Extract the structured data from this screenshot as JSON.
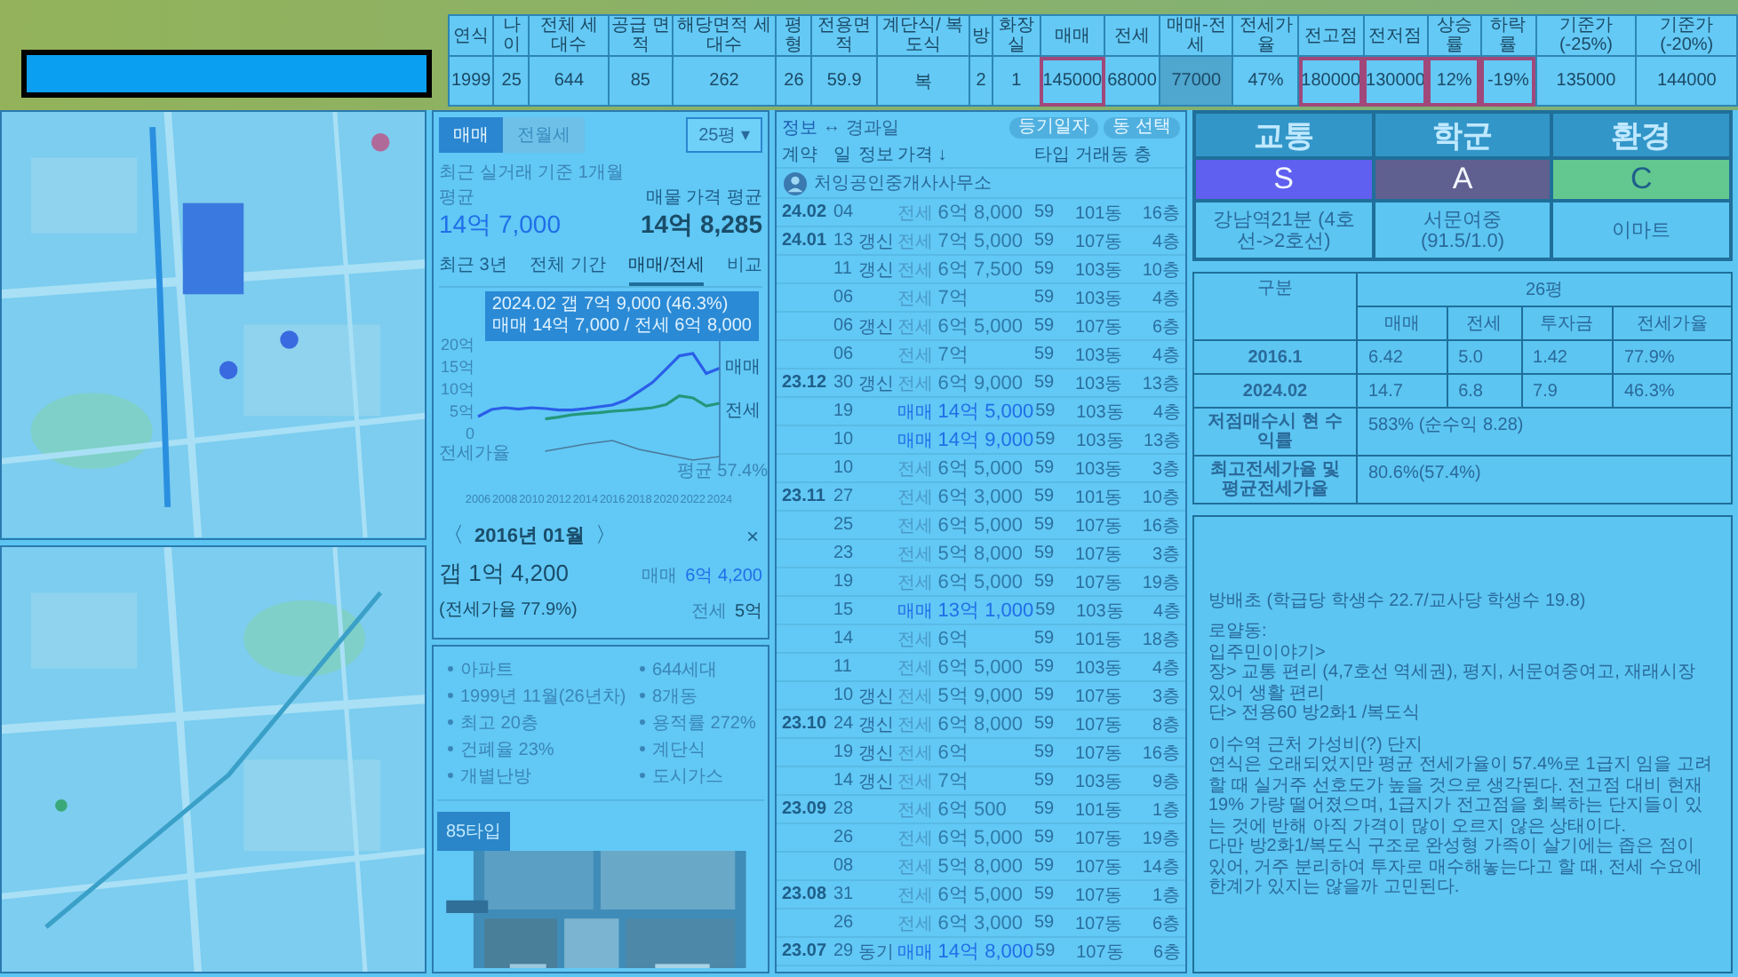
{
  "summary_table": {
    "columns": [
      "연식",
      "나이",
      "전체 세대수",
      "공급 면적",
      "해당면적 세대수",
      "평형",
      "전용면적",
      "계단식/ 복도식",
      "방",
      "화장실",
      "매매",
      "전세",
      "매매-전세",
      "전세가율",
      "전고점",
      "전저점",
      "상승률",
      "하락률",
      "기준가 (-25%)",
      "기준가 (-20%)"
    ],
    "cells": [
      {
        "text": "1999",
        "outlined": false,
        "shaded": false
      },
      {
        "text": "25",
        "outlined": false,
        "shaded": false
      },
      {
        "text": "644",
        "outlined": false,
        "shaded": false
      },
      {
        "text": "85",
        "outlined": false,
        "shaded": false
      },
      {
        "text": "262",
        "outlined": false,
        "shaded": false
      },
      {
        "text": "26",
        "outlined": false,
        "shaded": false
      },
      {
        "text": "59.9",
        "outlined": false,
        "shaded": false
      },
      {
        "text": "복",
        "outlined": false,
        "shaded": false
      },
      {
        "text": "2",
        "outlined": false,
        "shaded": false
      },
      {
        "text": "1",
        "outlined": false,
        "shaded": false
      },
      {
        "text": "145000",
        "outlined": true,
        "shaded": false
      },
      {
        "text": "68000",
        "outlined": false,
        "shaded": false
      },
      {
        "text": "77000",
        "outlined": false,
        "shaded": true
      },
      {
        "text": "47%",
        "outlined": false,
        "shaded": false
      },
      {
        "text": "180000",
        "outlined": true,
        "shaded": false
      },
      {
        "text": "130000",
        "outlined": true,
        "shaded": false
      },
      {
        "text": "12%",
        "outlined": true,
        "shaded": false
      },
      {
        "text": "-19%",
        "outlined": true,
        "shaded": false
      },
      {
        "text": "135000",
        "outlined": false,
        "shaded": false
      },
      {
        "text": "144000",
        "outlined": false,
        "shaded": false
      }
    ]
  },
  "price_panel": {
    "tabs": [
      {
        "label": "매매",
        "selected": true
      },
      {
        "label": "전월세",
        "selected": false
      }
    ],
    "size_select": {
      "value": "25평",
      "caret": "▾"
    },
    "recent_label": "최근 실거래 기준 1개월 평균",
    "recent_value": "14억 7,000",
    "listing_label": "매물 가격 평균",
    "listing_value": "14억 8,285",
    "views": [
      {
        "label": "최근 3년",
        "selected": false
      },
      {
        "label": "전체 기간",
        "selected": false
      },
      {
        "label": "매매/전세",
        "selected": true
      },
      {
        "label": "비교",
        "selected": false
      }
    ],
    "tooltip": {
      "title": "2024.02  갭 7억 9,000 (46.3%)",
      "detail": "매매 14억 7,000 / 전세 6억 8,000"
    },
    "ratio_axis_label": "전세가율",
    "average_label": "평균 57.4%",
    "chart_data": {
      "type": "line",
      "x": [
        2006,
        2007,
        2008,
        2009,
        2010,
        2011,
        2012,
        2013,
        2014,
        2015,
        2016,
        2017,
        2018,
        2019,
        2020,
        2021,
        2022,
        2023,
        2024
      ],
      "series": [
        {
          "name": "매매",
          "color": "#2a5ee8",
          "values": [
            3.8,
            5.4,
            5.8,
            5.5,
            5.8,
            5.6,
            5.3,
            5.3,
            5.6,
            6.0,
            6.4,
            7.5,
            9.5,
            11.5,
            14.5,
            17.5,
            18.0,
            13.5,
            14.7
          ]
        },
        {
          "name": "전세",
          "color": "#23967a",
          "values": [
            null,
            null,
            null,
            null,
            null,
            3.3,
            3.7,
            4.2,
            4.5,
            4.7,
            5.0,
            5.2,
            5.5,
            5.8,
            6.5,
            8.5,
            8.0,
            6.2,
            6.8
          ]
        }
      ],
      "xlim": [
        2006,
        2024
      ],
      "ylim": [
        0,
        20
      ],
      "yticks": [
        {
          "value": 0,
          "label": "0"
        },
        {
          "value": 5,
          "label": "5억"
        },
        {
          "value": 10,
          "label": "10억"
        },
        {
          "value": 15,
          "label": "15억"
        },
        {
          "value": 20,
          "label": "20억"
        }
      ],
      "xticks": [
        2006,
        2008,
        2010,
        2012,
        2014,
        2016,
        2018,
        2020,
        2022,
        2024
      ]
    },
    "detail": {
      "prev": "〈",
      "period": "2016년 01월",
      "next": "〉",
      "close": "×",
      "gap": "갭 1억 4,200",
      "ratio": "(전세가율 77.9%)",
      "sale_label": "매매",
      "sale_value": "6억 4,200",
      "jeonse_label": "전세",
      "jeonse_value": "5억"
    }
  },
  "complex_info": {
    "features": [
      "아파트",
      "644세대",
      "1999년 11월(26년차)",
      "8개동",
      "최고 20층",
      "용적률 272%",
      "건폐율 23%",
      "계단식",
      "개별난방",
      "도시가스"
    ],
    "plan_tab": "85타입"
  },
  "deals": {
    "toggle": [
      {
        "label": "정보",
        "selected": true
      },
      {
        "label": "경과일",
        "selected": false
      }
    ],
    "toggle_separator": "↔",
    "buttons": [
      "등기일자",
      "동 선택"
    ],
    "columns": [
      "계약",
      "일",
      "정보",
      "가격 ↓",
      "타입",
      "거래동",
      "층"
    ],
    "agent": "처잉공인중개사사무소",
    "rows": [
      {
        "month": "24.02",
        "day": "04",
        "kind": "jeonse",
        "type": "전세",
        "price": "6억 8,000",
        "area": "59",
        "dong": "101동",
        "floor": "16층"
      },
      {
        "month": "24.01",
        "day": "13",
        "info": "갱신",
        "kind": "jeonse",
        "type": "전세",
        "price": "7억 5,000",
        "area": "59",
        "dong": "107동",
        "floor": "4층"
      },
      {
        "day": "11",
        "info": "갱신",
        "kind": "jeonse",
        "type": "전세",
        "price": "6억 7,500",
        "area": "59",
        "dong": "103동",
        "floor": "10층"
      },
      {
        "day": "06",
        "kind": "jeonse",
        "type": "전세",
        "price": "7억",
        "area": "59",
        "dong": "103동",
        "floor": "4층"
      },
      {
        "day": "06",
        "info": "갱신",
        "kind": "jeonse",
        "type": "전세",
        "price": "6억 5,000",
        "area": "59",
        "dong": "107동",
        "floor": "6층"
      },
      {
        "day": "06",
        "kind": "jeonse",
        "type": "전세",
        "price": "7억",
        "area": "59",
        "dong": "103동",
        "floor": "4층"
      },
      {
        "month": "23.12",
        "day": "30",
        "info": "갱신",
        "kind": "jeonse",
        "type": "전세",
        "price": "6억 9,000",
        "area": "59",
        "dong": "103동",
        "floor": "13층"
      },
      {
        "day": "19",
        "kind": "sale",
        "type": "매매",
        "price": "14억 5,000",
        "area": "59",
        "dong": "103동",
        "floor": "4층"
      },
      {
        "day": "10",
        "kind": "sale",
        "type": "매매",
        "price": "14억 9,000",
        "area": "59",
        "dong": "103동",
        "floor": "13층"
      },
      {
        "day": "10",
        "kind": "jeonse",
        "type": "전세",
        "price": "6억 5,000",
        "area": "59",
        "dong": "103동",
        "floor": "3층"
      },
      {
        "month": "23.11",
        "day": "27",
        "kind": "jeonse",
        "type": "전세",
        "price": "6억 3,000",
        "area": "59",
        "dong": "101동",
        "floor": "10층"
      },
      {
        "day": "25",
        "kind": "jeonse",
        "type": "전세",
        "price": "6억 5,000",
        "area": "59",
        "dong": "107동",
        "floor": "16층"
      },
      {
        "day": "23",
        "kind": "jeonse",
        "type": "전세",
        "price": "5억 8,000",
        "area": "59",
        "dong": "107동",
        "floor": "3층"
      },
      {
        "day": "19",
        "kind": "jeonse",
        "type": "전세",
        "price": "6억 5,000",
        "area": "59",
        "dong": "107동",
        "floor": "19층"
      },
      {
        "day": "15",
        "kind": "sale",
        "type": "매매",
        "price": "13억 1,000",
        "area": "59",
        "dong": "103동",
        "floor": "4층"
      },
      {
        "day": "14",
        "kind": "jeonse",
        "type": "전세",
        "price": "6억",
        "area": "59",
        "dong": "101동",
        "floor": "18층"
      },
      {
        "day": "11",
        "kind": "jeonse",
        "type": "전세",
        "price": "6억 5,000",
        "area": "59",
        "dong": "103동",
        "floor": "4층"
      },
      {
        "day": "10",
        "info": "갱신",
        "kind": "jeonse",
        "type": "전세",
        "price": "5억 9,000",
        "area": "59",
        "dong": "107동",
        "floor": "3층"
      },
      {
        "month": "23.10",
        "day": "24",
        "info": "갱신",
        "kind": "jeonse",
        "type": "전세",
        "price": "6억 8,000",
        "area": "59",
        "dong": "107동",
        "floor": "8층"
      },
      {
        "day": "19",
        "info": "갱신",
        "kind": "jeonse",
        "type": "전세",
        "price": "6억",
        "area": "59",
        "dong": "107동",
        "floor": "16층"
      },
      {
        "day": "14",
        "info": "갱신",
        "kind": "jeonse",
        "type": "전세",
        "price": "7억",
        "area": "59",
        "dong": "103동",
        "floor": "9층"
      },
      {
        "month": "23.09",
        "day": "28",
        "kind": "jeonse",
        "type": "전세",
        "price": "6억 500",
        "area": "59",
        "dong": "101동",
        "floor": "1층"
      },
      {
        "day": "26",
        "kind": "jeonse",
        "type": "전세",
        "price": "6억 5,000",
        "area": "59",
        "dong": "107동",
        "floor": "19층"
      },
      {
        "day": "08",
        "kind": "jeonse",
        "type": "전세",
        "price": "5억 8,000",
        "area": "59",
        "dong": "107동",
        "floor": "14층"
      },
      {
        "month": "23.08",
        "day": "31",
        "kind": "jeonse",
        "type": "전세",
        "price": "6억 5,000",
        "area": "59",
        "dong": "107동",
        "floor": "1층"
      },
      {
        "day": "26",
        "kind": "jeonse",
        "type": "전세",
        "price": "6억 3,000",
        "area": "59",
        "dong": "107동",
        "floor": "6층"
      },
      {
        "month": "23.07",
        "day": "29",
        "info": "동기",
        "kind": "sale",
        "type": "매매",
        "price": "14억 8,000",
        "area": "59",
        "dong": "107동",
        "floor": "6층"
      }
    ]
  },
  "scores": [
    {
      "category": "교통",
      "grade": "S",
      "color": "#5f5ff0",
      "detail": "강남역21분 (4호선->2호선)"
    },
    {
      "category": "학군",
      "grade": "A",
      "color": "#5f6090",
      "detail": "서문여중 (91.5/1.0)"
    },
    {
      "category": "환경",
      "grade": "C",
      "color": "#62c890",
      "detail": "이마트"
    }
  ],
  "returns_table": {
    "corner": "구분",
    "group": "26평",
    "columns": [
      "매매",
      "전세",
      "투자금",
      "전세가율"
    ],
    "rows": [
      {
        "label": "2016.1",
        "values": [
          "6.42",
          "5.0",
          "1.42",
          "77.9%"
        ]
      },
      {
        "label": "2024.02",
        "values": [
          "14.7",
          "6.8",
          "7.9",
          "46.3%"
        ]
      }
    ],
    "summaries": [
      {
        "label": "저점매수시 현 수익률",
        "value": "583% (순수익 8.28)"
      },
      {
        "label": "최고전세가율 및 평균전세가율",
        "value": "80.6%(57.4%)"
      }
    ]
  },
  "note": {
    "sections": [
      [
        "방배초 (학급당 학생수 22.7/교사당 학생수 19.8)"
      ],
      [
        "로얄동:",
        "입주민이야기>",
        "장> 교통 편리 (4,7호선 역세권), 평지, 서문여중여고, 재래시장 있어 생활 편리",
        "단> 전용60 방2화1 /복도식"
      ],
      [
        "이수역 근처 가성비(?) 단지",
        "연식은 오래되었지만 평균 전세가율이 57.4%로 1급지 임을 고려할 때 실거주 선호도가 높을 것으로 생각된다. 전고점 대비 현재 19% 가량 떨어졌으며, 1급지가 전고점을 회복하는 단지들이 있는 것에 반해 아직 가격이 많이 오르지 않은 상태이다.",
        "다만 방2화1/복도식 구조로 완성형 가족이 살기에는 좁은 점이 있어, 거주 분리하여 투자로 매수해놓는다고 할 때, 전세 수요에 한계가 있지는 않을까 고민된다."
      ]
    ]
  }
}
